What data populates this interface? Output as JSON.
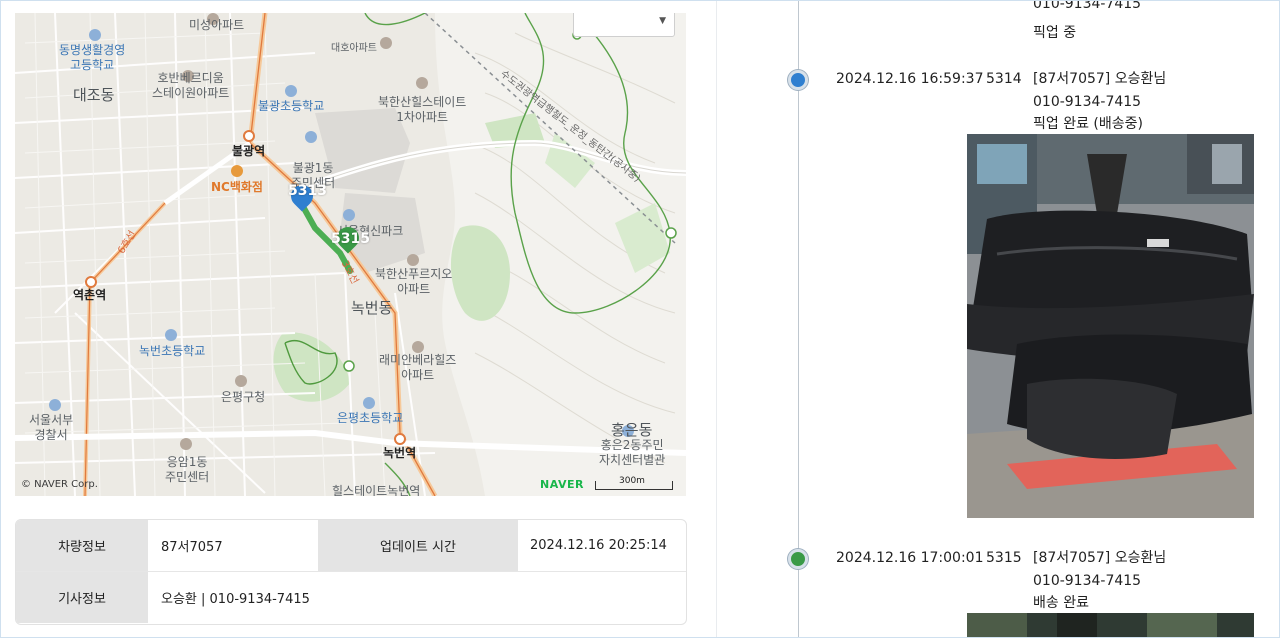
{
  "map": {
    "labels": {
      "school_dongmyeong": "동명생활경영\n고등학교",
      "misung_apt": "미성아파트",
      "daeho_apt": "대호아파트",
      "hoban_apt": "호반베르디움\n스테이원아파트",
      "daejo_dong": "대조동",
      "bulgwang_school": "불광초등학교",
      "bukhansan_hillstate": "북한산힐스테이트\n1차아파트",
      "bulgwang_station": "불광역",
      "bulgwang1_center": "불광1동\n주민센터",
      "nc_dept": "NC백화점",
      "seoul_park": "서울혁신파크",
      "bukhansan_prugio": "북한산푸르지오\n아파트",
      "yeokchon_station": "역촌역",
      "nokbeon_dong": "녹번동",
      "nokbeon_school": "녹번초등학교",
      "raemian": "래미안베라힐즈\n아파트",
      "eunpyeong_office": "은평구청",
      "seoul_seobu_police": "서울서부\n경찰서",
      "eunpyeong_school": "은평초등학교",
      "eungam1_center": "응암1동\n주민센터",
      "nokbeon_station": "녹번역",
      "hillstate_nokbeon": "힐스테이트녹번역",
      "hongeun2_center": "홍은2동주민\n자치센터별관",
      "hongeun_dong": "홍은동",
      "road_6": "6호선",
      "road_3": "3호선",
      "trail": "수도권광역급행철도_운정_동탄간(공사중)"
    },
    "markers": [
      {
        "text": "5313",
        "color": "#2f7fd0"
      },
      {
        "text": "5315",
        "color": "#3a9a47"
      }
    ],
    "copyright": "© NAVER Corp.",
    "brand": "NAVER",
    "scale_label": "300m"
  },
  "info_table": {
    "vehicle_label": "차량정보",
    "vehicle_value": "87서7057",
    "update_label": "업데이트 시간",
    "update_value": "2024.12.16 20:25:14",
    "driver_label": "기사정보",
    "driver_value": "오승환 | 010-9134-7415"
  },
  "timeline": {
    "top_partial": {
      "phone": "010-9134-7415",
      "status": "픽업 중"
    },
    "events": [
      {
        "time": "2024.12.16 16:59:37",
        "stop": "5314",
        "driver": "[87서7057] 오승환님",
        "phone": "010-9134-7415",
        "status": "픽업 완료 (배송중)",
        "dot_color": "#2f7fd0"
      },
      {
        "time": "2024.12.16 17:00:01",
        "stop": "5315",
        "driver": "[87서7057] 오승환님",
        "phone": "010-9134-7415",
        "status": "배송 완료",
        "dot_color": "#3a9a47"
      }
    ]
  },
  "colors": {
    "accent_blue": "#2f7fd0",
    "accent_green": "#3a9a47",
    "table_header": "#e4e4e4"
  }
}
